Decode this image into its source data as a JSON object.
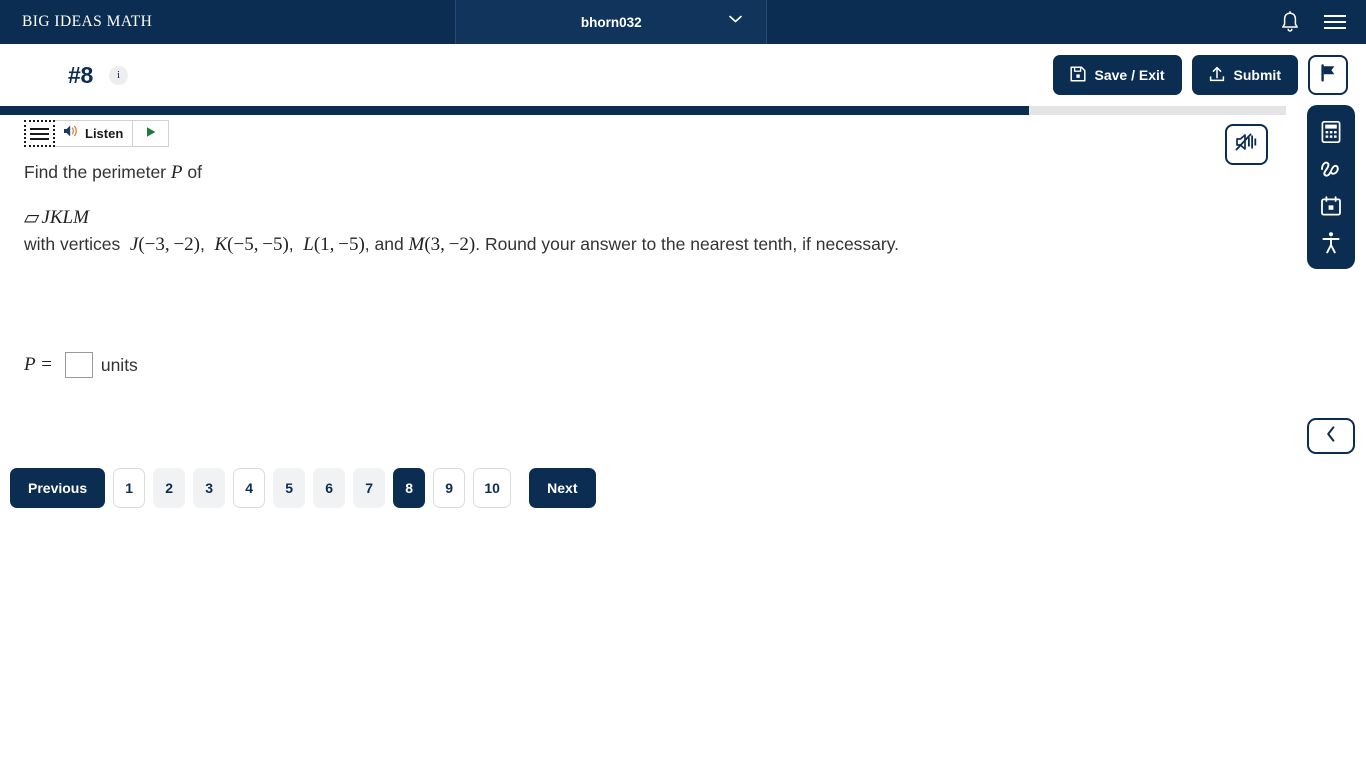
{
  "topnav": {
    "brand": "BIG IDEAS MATH",
    "username": "bhorn032",
    "chevron_icon": "chevron-down-icon",
    "bell_icon": "notification-bell-icon",
    "menu_icon": "hamburger-menu-icon"
  },
  "subheader": {
    "question_number": "#8",
    "info_label": "i",
    "save_exit_label": "Save / Exit",
    "submit_label": "Submit",
    "save_icon": "floppy-disk-icon",
    "submit_icon": "upload-icon",
    "flag_icon": "flag-icon"
  },
  "progress": {
    "percent": 80
  },
  "listen": {
    "handle_icon": "drag-handle-icon",
    "speaker_icon": "speaker-icon",
    "label": "Listen",
    "play_icon": "play-triangle-icon"
  },
  "mute": {
    "icon": "speaker-mute-icon"
  },
  "question": {
    "prompt_prefix": "Find the perimeter",
    "prompt_var": "P",
    "prompt_suffix": "of",
    "shape_glyph": "▱",
    "shape_name": "JKLM",
    "vertices_lead": "with vertices",
    "points": [
      {
        "label": "J",
        "x": "−3",
        "y": "−2"
      },
      {
        "label": "K",
        "x": "−5",
        "y": "−5"
      },
      {
        "label": "L",
        "x": "1",
        "y": "−5"
      },
      {
        "label": "M",
        "x": "3",
        "y": "−2"
      }
    ],
    "separator": ", ",
    "and_word": ", and",
    "instruction": ". Round your answer to the nearest tenth, if necessary."
  },
  "answer": {
    "label": "P =",
    "value": "",
    "units": "units"
  },
  "pagination": {
    "previous_label": "Previous",
    "next_label": "Next",
    "pages": [
      {
        "label": "1",
        "state": "plain"
      },
      {
        "label": "2",
        "state": "filled"
      },
      {
        "label": "3",
        "state": "filled"
      },
      {
        "label": "4",
        "state": "plain"
      },
      {
        "label": "5",
        "state": "filled"
      },
      {
        "label": "6",
        "state": "filled"
      },
      {
        "label": "7",
        "state": "filled"
      },
      {
        "label": "8",
        "state": "active"
      },
      {
        "label": "9",
        "state": "plain"
      },
      {
        "label": "10",
        "state": "plain"
      }
    ]
  },
  "toolbar": {
    "items": [
      {
        "icon": "calculator-icon"
      },
      {
        "icon": "draw-scribble-icon"
      },
      {
        "icon": "notes-calendar-icon"
      },
      {
        "icon": "accessibility-icon"
      }
    ],
    "collapse_icon": "chevron-left-icon"
  },
  "colors": {
    "navy": "#0c2d52",
    "navy_panel": "#11345c",
    "gray_fill": "#f1f2f4",
    "progress_track": "#e4e4e6",
    "green": "#1f7a3d",
    "orange": "#e07a28"
  }
}
